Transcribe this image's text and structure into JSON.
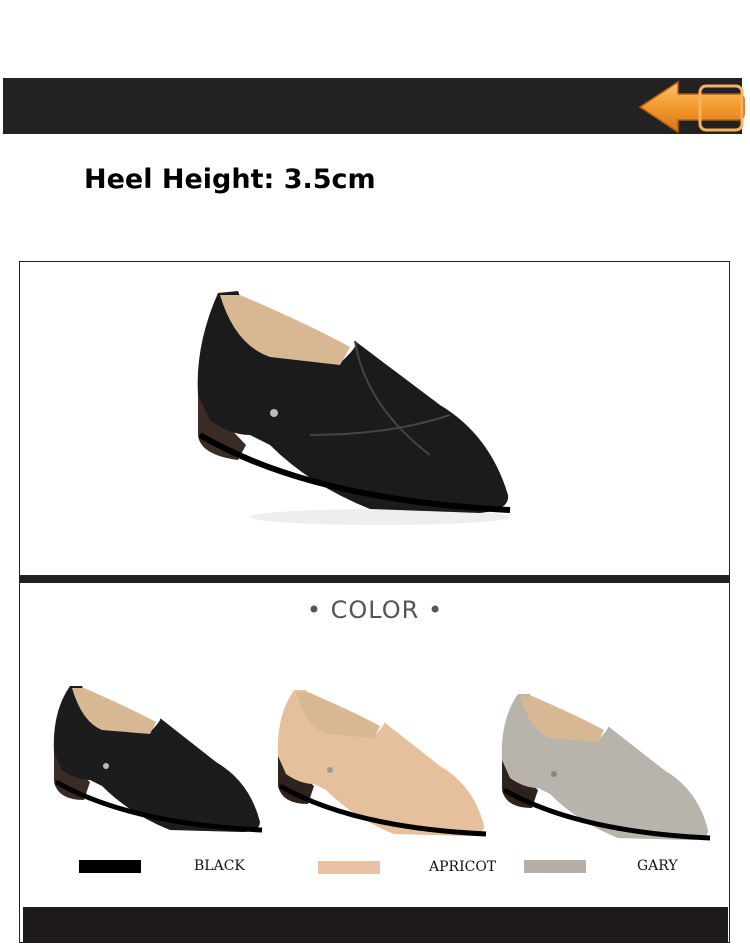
{
  "heel": {
    "text": "Heel Height: 3.5cm"
  },
  "color_section": {
    "title": "• COLOR •"
  },
  "colors": [
    {
      "name": "BLACK",
      "swatch": "#000000",
      "shoe_upper": "#1c1c1e",
      "shoe_shade": "#0c0c0d"
    },
    {
      "name": "APRICOT",
      "swatch": "#e9c2a6",
      "shoe_upper": "#e6bf9c",
      "shoe_shade": "#cfa280"
    },
    {
      "name": "GARY",
      "swatch": "#b7aea6",
      "shoe_upper": "#b8b4ac",
      "shoe_shade": "#9d9991"
    }
  ],
  "accent": {
    "arrow": "#f0922a",
    "bars": "#222222"
  }
}
